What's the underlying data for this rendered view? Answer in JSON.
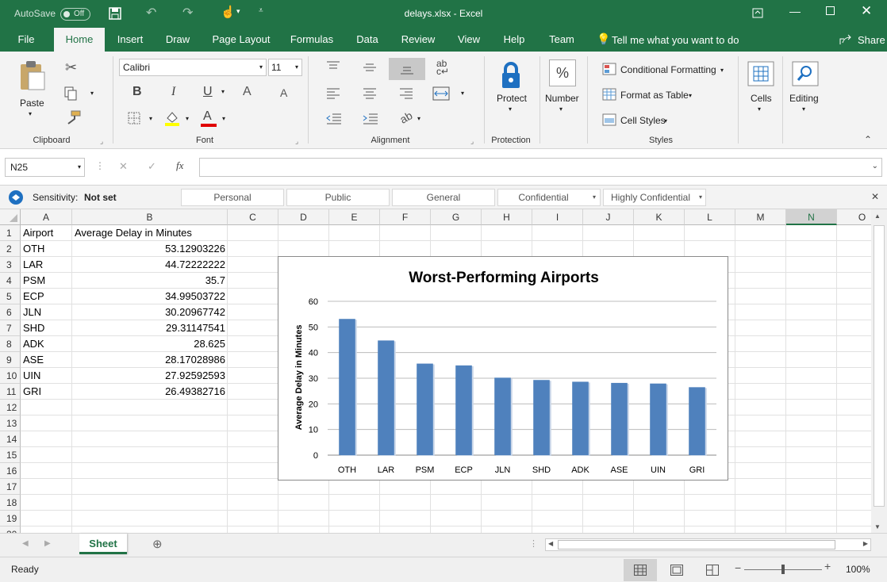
{
  "titlebar": {
    "autosave_label": "AutoSave",
    "autosave_state": "Off",
    "title": "delays.xlsx  -  Excel"
  },
  "tabs": [
    "File",
    "Home",
    "Insert",
    "Draw",
    "Page Layout",
    "Formulas",
    "Data",
    "Review",
    "View",
    "Help",
    "Team"
  ],
  "active_tab": "Home",
  "tell_me": "Tell me what you want to do",
  "share": "Share",
  "ribbon": {
    "clipboard": {
      "paste": "Paste",
      "group": "Clipboard"
    },
    "font": {
      "name": "Calibri",
      "size": "11",
      "group": "Font",
      "bold": "B",
      "italic": "I",
      "underline": "U",
      "grow": "A",
      "shrink": "A"
    },
    "alignment": {
      "group": "Alignment"
    },
    "protection": {
      "protect": "Protect",
      "group": "Protection"
    },
    "number": {
      "label": "Number",
      "symbol": "%"
    },
    "styles": {
      "conditional": "Conditional Formatting",
      "format_table": "Format as Table",
      "cell_styles": "Cell Styles",
      "group": "Styles"
    },
    "cells": {
      "label": "Cells"
    },
    "editing": {
      "label": "Editing"
    }
  },
  "formula_bar": {
    "name_box": "N25",
    "fx": "fx",
    "formula": ""
  },
  "sensitivity": {
    "label": "Sensitivity:",
    "value": "Not set",
    "options": [
      "Personal",
      "Public",
      "General",
      "Confidential",
      "Highly Confidential"
    ]
  },
  "columns": [
    "A",
    "B",
    "C",
    "D",
    "E",
    "F",
    "G",
    "H",
    "I",
    "J",
    "K",
    "L",
    "M",
    "N",
    "O"
  ],
  "selected_column": "N",
  "rows": [
    "1",
    "2",
    "3",
    "4",
    "5",
    "6",
    "7",
    "8",
    "9",
    "10",
    "11",
    "12",
    "13",
    "14",
    "15",
    "16",
    "17",
    "18",
    "19",
    "20"
  ],
  "table": {
    "headers": [
      "Airport",
      "Average Delay in Minutes"
    ],
    "data": [
      [
        "OTH",
        "53.12903226"
      ],
      [
        "LAR",
        "44.72222222"
      ],
      [
        "PSM",
        "35.7"
      ],
      [
        "ECP",
        "34.99503722"
      ],
      [
        "JLN",
        "30.20967742"
      ],
      [
        "SHD",
        "29.31147541"
      ],
      [
        "ADK",
        "28.625"
      ],
      [
        "ASE",
        "28.17028986"
      ],
      [
        "UIN",
        "27.92592593"
      ],
      [
        "GRI",
        "26.49382716"
      ]
    ]
  },
  "chart_data": {
    "type": "bar",
    "title": "Worst-Performing Airports",
    "xlabel": "",
    "ylabel": "Average Delay in Minutes",
    "categories": [
      "OTH",
      "LAR",
      "PSM",
      "ECP",
      "JLN",
      "SHD",
      "ADK",
      "ASE",
      "UIN",
      "GRI"
    ],
    "values": [
      53.12903226,
      44.72222222,
      35.7,
      34.99503722,
      30.20967742,
      29.31147541,
      28.625,
      28.17028986,
      27.92592593,
      26.49382716
    ],
    "ylim": [
      0,
      60
    ],
    "yticks": [
      "0",
      "10",
      "20",
      "30",
      "40",
      "50",
      "60"
    ],
    "grid": true,
    "legend": "none",
    "bar_color": "#4f81bd"
  },
  "sheet_tab": "Sheet",
  "status": {
    "ready": "Ready",
    "zoom": "100%"
  },
  "colors": {
    "excel_green": "#217346",
    "ribbon_bg": "#f3f3f3",
    "font_highlight": "#ffff00",
    "font_color": "#e00000"
  }
}
